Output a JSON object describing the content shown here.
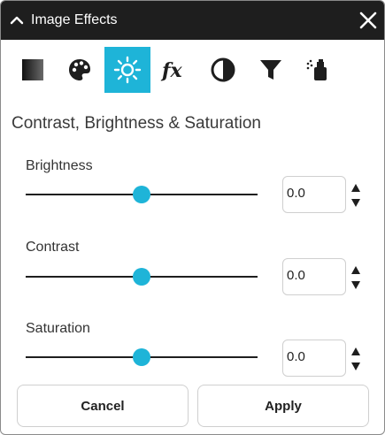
{
  "window": {
    "title": "Image Effects"
  },
  "toolbar": {
    "buttons": [
      {
        "icon": "gradient-square-icon",
        "active": false
      },
      {
        "icon": "palette-icon",
        "active": false
      },
      {
        "icon": "brightness-sun-icon",
        "active": true
      },
      {
        "icon": "fx-function-icon",
        "active": false
      },
      {
        "icon": "contrast-half-circle-icon",
        "active": false
      },
      {
        "icon": "filter-funnel-icon",
        "active": false
      },
      {
        "icon": "spray-can-icon",
        "active": false
      }
    ],
    "active_color": "#1eb4d8"
  },
  "section": {
    "heading": "Contrast, Brightness & Saturation"
  },
  "controls": [
    {
      "label": "Brightness",
      "value": "0.0",
      "slider_fraction": 0.5
    },
    {
      "label": "Contrast",
      "value": "0.0",
      "slider_fraction": 0.5
    },
    {
      "label": "Saturation",
      "value": "0.0",
      "slider_fraction": 0.5
    }
  ],
  "footer": {
    "cancel_label": "Cancel",
    "apply_label": "Apply"
  },
  "colors": {
    "titlebar": "#1e1e1e",
    "accent": "#1eb4d8",
    "text": "#333333"
  }
}
